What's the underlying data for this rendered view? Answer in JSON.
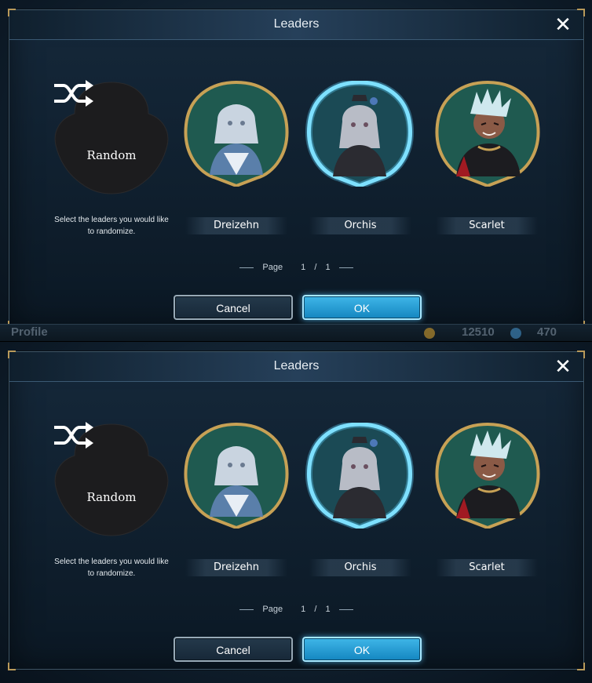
{
  "background": {
    "profile_label": "Profile",
    "gold_amount": "12510",
    "crystal_amount": "470"
  },
  "dialog": {
    "title": "Leaders",
    "close_glyph": "✕",
    "random": {
      "label": "Random",
      "icon": "shuffle-icon",
      "description": "Select the leaders you would like to randomize."
    },
    "leaders": [
      {
        "name": "Dreizehn",
        "selected": false,
        "frame_color": "#c7a155",
        "bg_color": "#1f5a50"
      },
      {
        "name": "Orchis",
        "selected": true,
        "frame_color": "#8fe6ff",
        "bg_color": "#1b4a55"
      },
      {
        "name": "Scarlet",
        "selected": false,
        "frame_color": "#c7a155",
        "bg_color": "#1f5a50"
      }
    ],
    "pager": {
      "label": "Page",
      "current": "1",
      "separator": "/",
      "total": "1"
    },
    "cancel_label": "Cancel",
    "ok_label": "OK"
  },
  "colors": {
    "accent": "#27a8e0",
    "gold_frame": "#c7a155",
    "selected_glow": "#5fd3ff"
  }
}
